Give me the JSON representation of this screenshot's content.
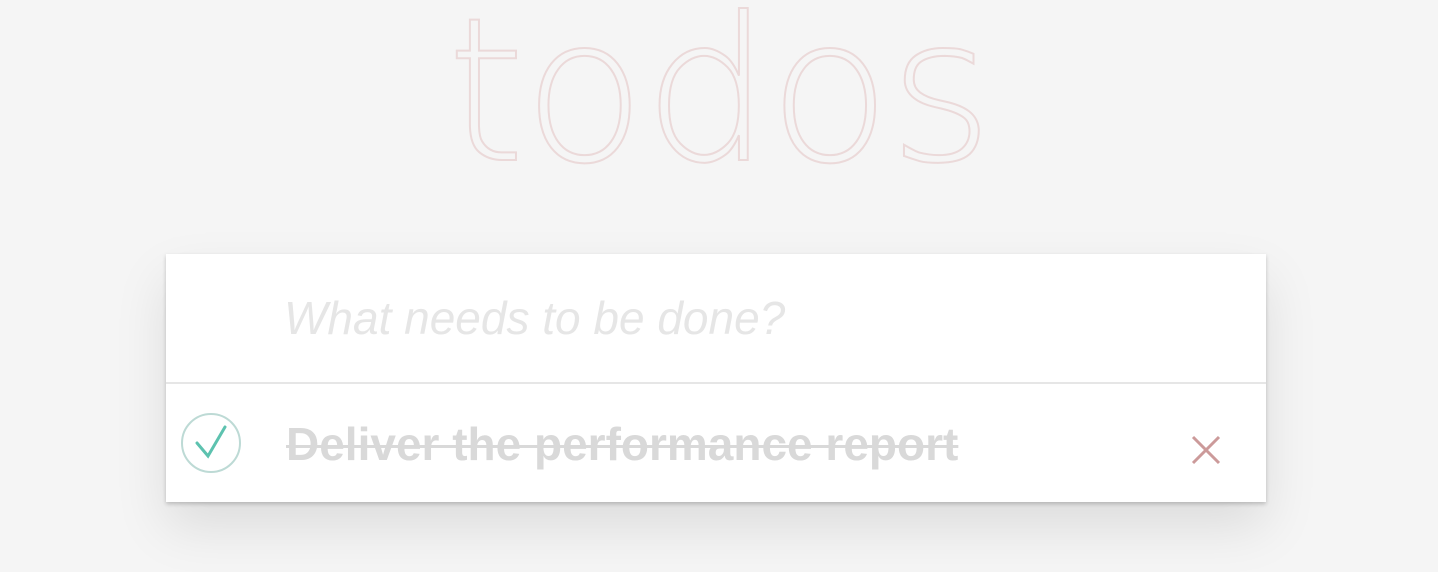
{
  "header": {
    "title": "todos"
  },
  "new_todo": {
    "placeholder": "What needs to be done?",
    "value": ""
  },
  "todos": [
    {
      "label": "Deliver the performance report",
      "completed": true,
      "toggle_icon": "checkmark-circle-icon",
      "destroy_icon": "close-icon"
    }
  ],
  "colors": {
    "background": "#f5f5f5",
    "panel": "#ffffff",
    "title": "#efd5d5",
    "check": "#5dc2af",
    "check_ring": "#bddad5",
    "destroy": "#cc9a9a",
    "completed_text": "#d9d9d9",
    "placeholder": "#e6e6e6"
  }
}
